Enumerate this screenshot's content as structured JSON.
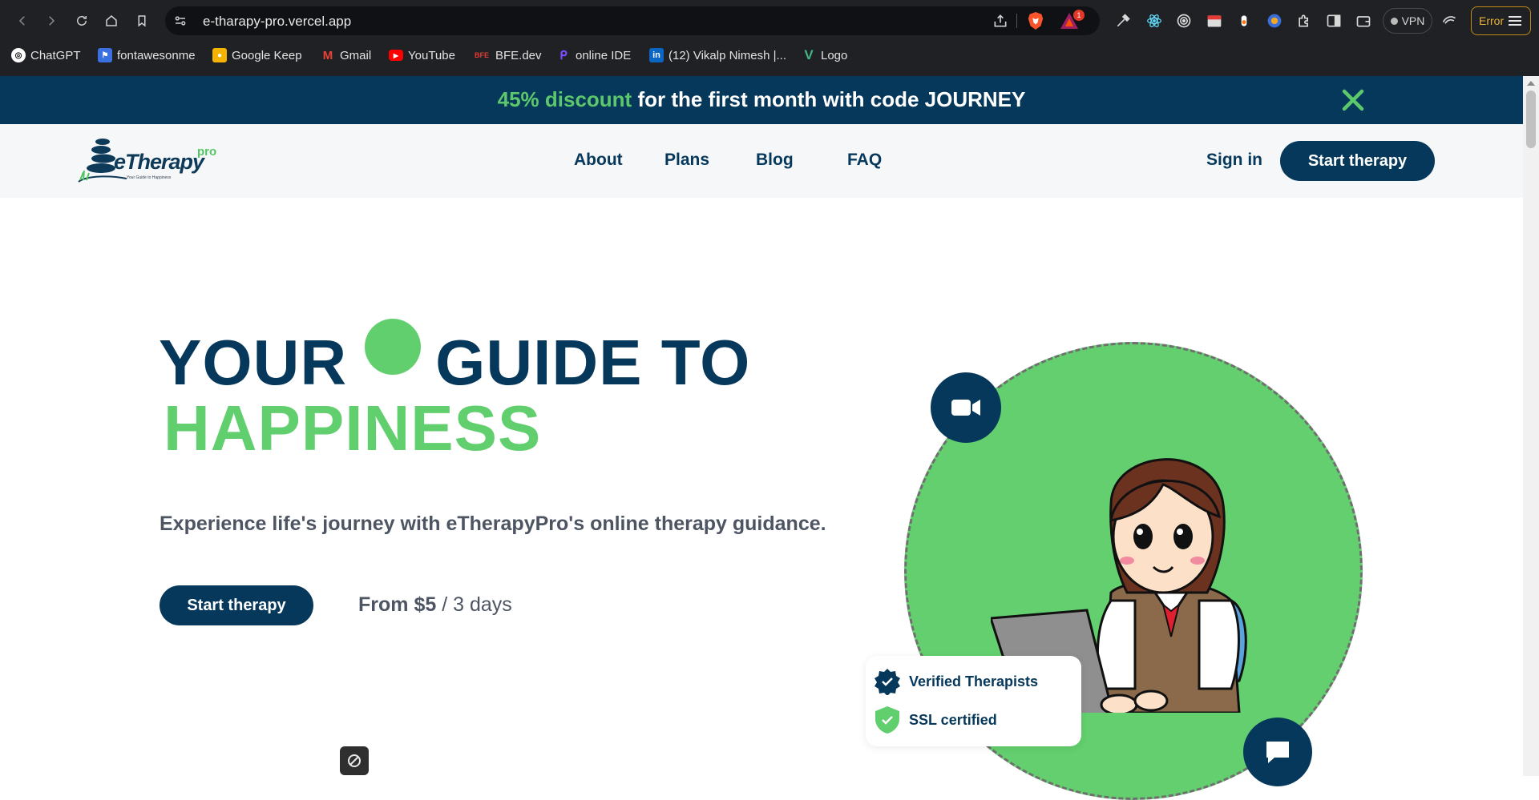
{
  "browser": {
    "url": "e-tharapy-pro.vercel.app",
    "shields_badge": "1",
    "vpn_label": "VPN",
    "error_label": "Error",
    "bookmarks": [
      {
        "label": "ChatGPT",
        "icon": "chatgpt-icon",
        "color": "#ffffff"
      },
      {
        "label": "fontawesonme",
        "icon": "flag-icon",
        "color": "#3c6fe0"
      },
      {
        "label": "Google Keep",
        "icon": "keep-icon",
        "color": "#f4b400"
      },
      {
        "label": "Gmail",
        "icon": "gmail-icon",
        "color": "#ea4335"
      },
      {
        "label": "YouTube",
        "icon": "youtube-icon",
        "color": "#ff0000"
      },
      {
        "label": "BFE.dev",
        "icon": "bfe-icon",
        "color": "#e53935"
      },
      {
        "label": "online IDE",
        "icon": "ide-icon",
        "color": "#7c4dff"
      },
      {
        "label": "(12) Vikalp Nimesh |...",
        "icon": "linkedin-icon",
        "color": "#0a66c2"
      },
      {
        "label": "Logo",
        "icon": "vue-icon",
        "color": "#42b883"
      }
    ]
  },
  "promo": {
    "highlight": "45% discount",
    "text": " for the first month with code JOURNEY"
  },
  "header": {
    "logo_text": "eTherapy",
    "logo_suffix": "pro",
    "logo_tagline": "Your Guide to Happiness",
    "nav": [
      "About",
      "Plans",
      "Blog",
      "FAQ"
    ],
    "sign_in": "Sign in",
    "cta": "Start therapy"
  },
  "hero": {
    "title_part1": "YOUR",
    "title_part2": "GUIDE TO",
    "title_line2": "HAPPINESS",
    "subtitle": "Experience life's journey with eTherapyPro's online therapy guidance.",
    "cta": "Start therapy",
    "price_from": "From $5",
    "price_period": " / 3 days",
    "trust": [
      "Verified Therapists",
      "SSL certified"
    ]
  },
  "colors": {
    "primary": "#06385b",
    "accent": "#62cf6f"
  }
}
